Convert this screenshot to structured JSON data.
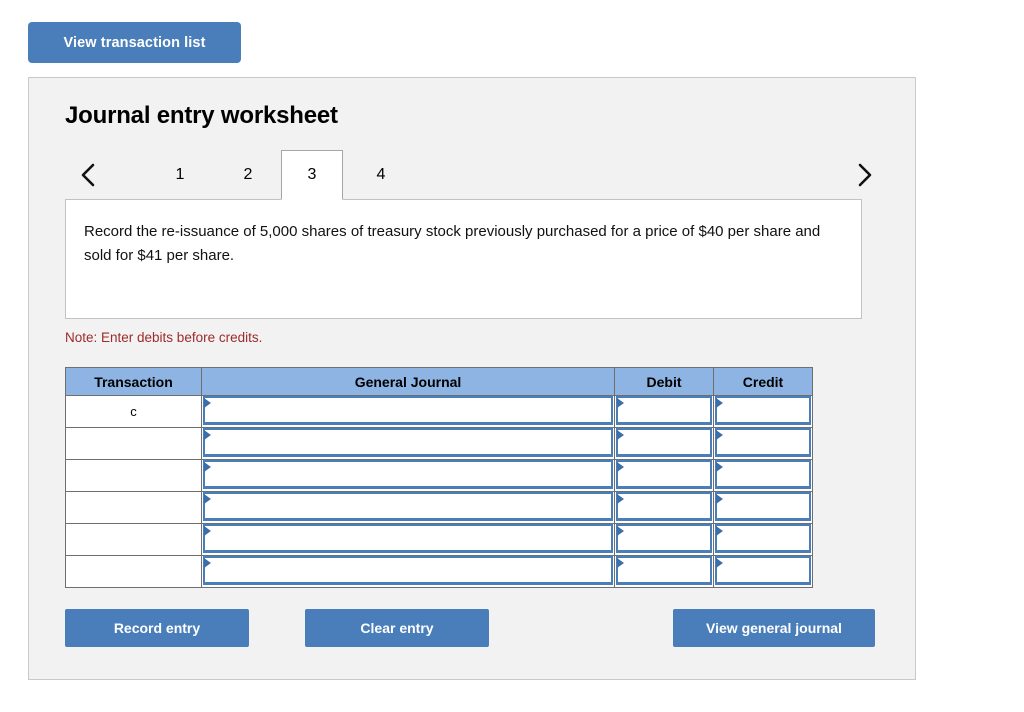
{
  "top_bar": {
    "view_transaction_list_label": "View transaction list"
  },
  "worksheet": {
    "title": "Journal entry worksheet",
    "tabs": [
      {
        "label": "1",
        "active": false
      },
      {
        "label": "2",
        "active": false
      },
      {
        "label": "3",
        "active": true
      },
      {
        "label": "4",
        "active": false
      }
    ],
    "nav": {
      "prev_icon": "chevron-left-icon",
      "next_icon": "chevron-right-icon"
    },
    "description": "Record the re-issuance of 5,000 shares of treasury stock previously purchased for a price of $40 per share and sold for $41 per share.",
    "note": "Note: Enter debits before credits."
  },
  "table": {
    "headers": [
      "Transaction",
      "General Journal",
      "Debit",
      "Credit"
    ],
    "rows": [
      {
        "transaction": "c",
        "general_journal": "",
        "debit": "",
        "credit": ""
      },
      {
        "transaction": "",
        "general_journal": "",
        "debit": "",
        "credit": ""
      },
      {
        "transaction": "",
        "general_journal": "",
        "debit": "",
        "credit": ""
      },
      {
        "transaction": "",
        "general_journal": "",
        "debit": "",
        "credit": ""
      },
      {
        "transaction": "",
        "general_journal": "",
        "debit": "",
        "credit": ""
      },
      {
        "transaction": "",
        "general_journal": "",
        "debit": "",
        "credit": ""
      }
    ]
  },
  "actions": {
    "record_entry_label": "Record entry",
    "clear_entry_label": "Clear entry",
    "view_general_journal_label": "View general journal"
  },
  "colors": {
    "button_blue": "#4a7ebb",
    "header_blue": "#8db4e2",
    "panel_gray": "#f2f2f2",
    "note_red": "#9e2a2b"
  }
}
